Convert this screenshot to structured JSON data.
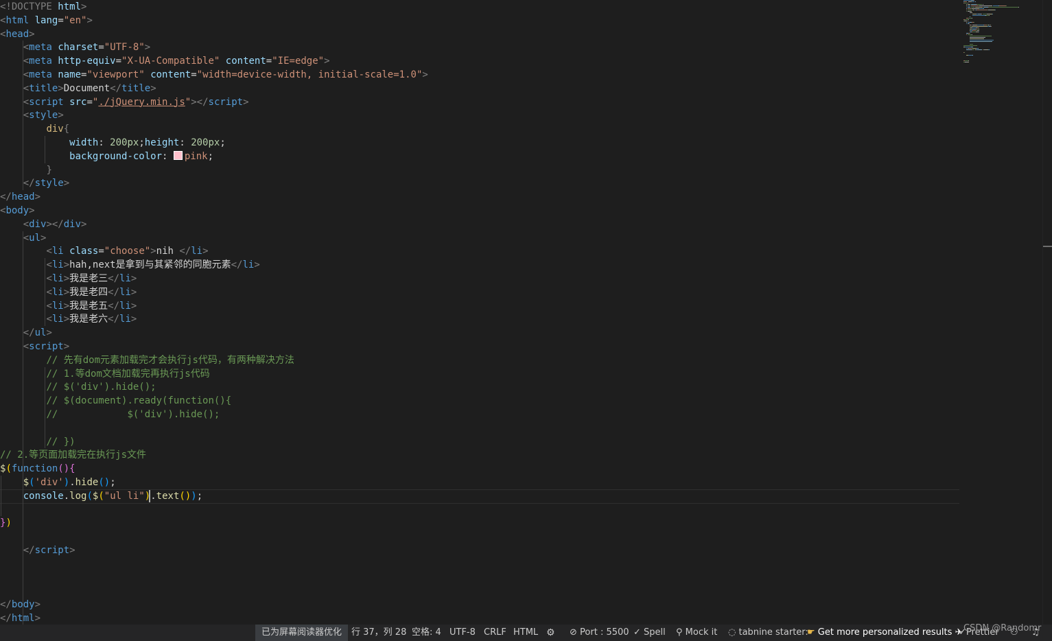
{
  "code_lines": [
    {
      "segments": [
        {
          "t": "<!DOCTYPE ",
          "c": "br"
        },
        {
          "t": "html",
          "c": "attr"
        },
        {
          "t": ">",
          "c": "br"
        }
      ]
    },
    {
      "segments": [
        {
          "t": "<",
          "c": "br"
        },
        {
          "t": "html",
          "c": "tag"
        },
        {
          "t": " ",
          "c": "txt"
        },
        {
          "t": "lang",
          "c": "attr"
        },
        {
          "t": "=",
          "c": "txt"
        },
        {
          "t": "\"en\"",
          "c": "str"
        },
        {
          "t": ">",
          "c": "br"
        }
      ]
    },
    {
      "segments": [
        {
          "t": "<",
          "c": "br"
        },
        {
          "t": "head",
          "c": "tag"
        },
        {
          "t": ">",
          "c": "br"
        }
      ]
    },
    {
      "segments": [
        {
          "t": "    ",
          "c": "txt"
        },
        {
          "t": "<",
          "c": "br"
        },
        {
          "t": "meta",
          "c": "tag"
        },
        {
          "t": " ",
          "c": "txt"
        },
        {
          "t": "charset",
          "c": "attr"
        },
        {
          "t": "=",
          "c": "txt"
        },
        {
          "t": "\"UTF-8\"",
          "c": "str"
        },
        {
          "t": ">",
          "c": "br"
        }
      ]
    },
    {
      "segments": [
        {
          "t": "    ",
          "c": "txt"
        },
        {
          "t": "<",
          "c": "br"
        },
        {
          "t": "meta",
          "c": "tag"
        },
        {
          "t": " ",
          "c": "txt"
        },
        {
          "t": "http-equiv",
          "c": "attr"
        },
        {
          "t": "=",
          "c": "txt"
        },
        {
          "t": "\"X-UA-Compatible\"",
          "c": "str"
        },
        {
          "t": " ",
          "c": "txt"
        },
        {
          "t": "content",
          "c": "attr"
        },
        {
          "t": "=",
          "c": "txt"
        },
        {
          "t": "\"IE=edge\"",
          "c": "str"
        },
        {
          "t": ">",
          "c": "br"
        }
      ]
    },
    {
      "segments": [
        {
          "t": "    ",
          "c": "txt"
        },
        {
          "t": "<",
          "c": "br"
        },
        {
          "t": "meta",
          "c": "tag"
        },
        {
          "t": " ",
          "c": "txt"
        },
        {
          "t": "name",
          "c": "attr"
        },
        {
          "t": "=",
          "c": "txt"
        },
        {
          "t": "\"viewport\"",
          "c": "str"
        },
        {
          "t": " ",
          "c": "txt"
        },
        {
          "t": "content",
          "c": "attr"
        },
        {
          "t": "=",
          "c": "txt"
        },
        {
          "t": "\"width=device-width, initial-scale=1.0\"",
          "c": "str"
        },
        {
          "t": ">",
          "c": "br"
        }
      ]
    },
    {
      "segments": [
        {
          "t": "    ",
          "c": "txt"
        },
        {
          "t": "<",
          "c": "br"
        },
        {
          "t": "title",
          "c": "tag"
        },
        {
          "t": ">",
          "c": "br"
        },
        {
          "t": "Document",
          "c": "txt"
        },
        {
          "t": "</",
          "c": "br"
        },
        {
          "t": "title",
          "c": "tag"
        },
        {
          "t": ">",
          "c": "br"
        }
      ]
    },
    {
      "segments": [
        {
          "t": "    ",
          "c": "txt"
        },
        {
          "t": "<",
          "c": "br"
        },
        {
          "t": "script",
          "c": "tag"
        },
        {
          "t": " ",
          "c": "txt"
        },
        {
          "t": "src",
          "c": "attr"
        },
        {
          "t": "=",
          "c": "txt"
        },
        {
          "t": "\"",
          "c": "str"
        },
        {
          "t": "./jQuery.min.js",
          "c": "link"
        },
        {
          "t": "\"",
          "c": "str"
        },
        {
          "t": "></",
          "c": "br"
        },
        {
          "t": "script",
          "c": "tag"
        },
        {
          "t": ">",
          "c": "br"
        }
      ]
    },
    {
      "segments": [
        {
          "t": "    ",
          "c": "txt"
        },
        {
          "t": "<",
          "c": "br"
        },
        {
          "t": "style",
          "c": "tag"
        },
        {
          "t": ">",
          "c": "br"
        }
      ]
    },
    {
      "segments": [
        {
          "t": "        ",
          "c": "txt"
        },
        {
          "t": "div",
          "c": "sel"
        },
        {
          "t": "{",
          "c": "br"
        }
      ]
    },
    {
      "segments": [
        {
          "t": "            ",
          "c": "txt"
        },
        {
          "t": "width",
          "c": "prop"
        },
        {
          "t": ": ",
          "c": "txt"
        },
        {
          "t": "200px",
          "c": "num"
        },
        {
          "t": ";",
          "c": "txt"
        },
        {
          "t": "height",
          "c": "prop"
        },
        {
          "t": ": ",
          "c": "txt"
        },
        {
          "t": "200px",
          "c": "num"
        },
        {
          "t": ";",
          "c": "txt"
        }
      ]
    },
    {
      "segments": [
        {
          "t": "            ",
          "c": "txt"
        },
        {
          "t": "background-color",
          "c": "prop"
        },
        {
          "t": ": ",
          "c": "txt"
        },
        {
          "t": "",
          "c": "swatch"
        },
        {
          "t": "pink",
          "c": "str"
        },
        {
          "t": ";",
          "c": "txt"
        }
      ]
    },
    {
      "segments": [
        {
          "t": "        ",
          "c": "txt"
        },
        {
          "t": "}",
          "c": "br"
        }
      ]
    },
    {
      "segments": [
        {
          "t": "    ",
          "c": "txt"
        },
        {
          "t": "</",
          "c": "br"
        },
        {
          "t": "style",
          "c": "tag"
        },
        {
          "t": ">",
          "c": "br"
        }
      ]
    },
    {
      "segments": [
        {
          "t": "</",
          "c": "br"
        },
        {
          "t": "head",
          "c": "tag"
        },
        {
          "t": ">",
          "c": "br"
        }
      ]
    },
    {
      "segments": [
        {
          "t": "<",
          "c": "br"
        },
        {
          "t": "body",
          "c": "tag"
        },
        {
          "t": ">",
          "c": "br"
        }
      ]
    },
    {
      "segments": [
        {
          "t": "    ",
          "c": "txt"
        },
        {
          "t": "<",
          "c": "br"
        },
        {
          "t": "div",
          "c": "tag"
        },
        {
          "t": "></",
          "c": "br"
        },
        {
          "t": "div",
          "c": "tag"
        },
        {
          "t": ">",
          "c": "br"
        }
      ]
    },
    {
      "segments": [
        {
          "t": "    ",
          "c": "txt"
        },
        {
          "t": "<",
          "c": "br"
        },
        {
          "t": "ul",
          "c": "tag"
        },
        {
          "t": ">",
          "c": "br"
        }
      ]
    },
    {
      "segments": [
        {
          "t": "        ",
          "c": "txt"
        },
        {
          "t": "<",
          "c": "br"
        },
        {
          "t": "li",
          "c": "tag"
        },
        {
          "t": " ",
          "c": "txt"
        },
        {
          "t": "class",
          "c": "attr"
        },
        {
          "t": "=",
          "c": "txt"
        },
        {
          "t": "\"choose\"",
          "c": "str"
        },
        {
          "t": ">",
          "c": "br"
        },
        {
          "t": "nih ",
          "c": "txt"
        },
        {
          "t": "</",
          "c": "br"
        },
        {
          "t": "li",
          "c": "tag"
        },
        {
          "t": ">",
          "c": "br"
        }
      ]
    },
    {
      "segments": [
        {
          "t": "        ",
          "c": "txt"
        },
        {
          "t": "<",
          "c": "br"
        },
        {
          "t": "li",
          "c": "tag"
        },
        {
          "t": ">",
          "c": "br"
        },
        {
          "t": "hah,next是拿到与其紧邻的同胞元素",
          "c": "txt"
        },
        {
          "t": "</",
          "c": "br"
        },
        {
          "t": "li",
          "c": "tag"
        },
        {
          "t": ">",
          "c": "br"
        }
      ]
    },
    {
      "segments": [
        {
          "t": "        ",
          "c": "txt"
        },
        {
          "t": "<",
          "c": "br"
        },
        {
          "t": "li",
          "c": "tag"
        },
        {
          "t": ">",
          "c": "br"
        },
        {
          "t": "我是老三",
          "c": "txt"
        },
        {
          "t": "</",
          "c": "br"
        },
        {
          "t": "li",
          "c": "tag"
        },
        {
          "t": ">",
          "c": "br"
        }
      ]
    },
    {
      "segments": [
        {
          "t": "        ",
          "c": "txt"
        },
        {
          "t": "<",
          "c": "br"
        },
        {
          "t": "li",
          "c": "tag"
        },
        {
          "t": ">",
          "c": "br"
        },
        {
          "t": "我是老四",
          "c": "txt"
        },
        {
          "t": "</",
          "c": "br"
        },
        {
          "t": "li",
          "c": "tag"
        },
        {
          "t": ">",
          "c": "br"
        }
      ]
    },
    {
      "segments": [
        {
          "t": "        ",
          "c": "txt"
        },
        {
          "t": "<",
          "c": "br"
        },
        {
          "t": "li",
          "c": "tag"
        },
        {
          "t": ">",
          "c": "br"
        },
        {
          "t": "我是老五",
          "c": "txt"
        },
        {
          "t": "</",
          "c": "br"
        },
        {
          "t": "li",
          "c": "tag"
        },
        {
          "t": ">",
          "c": "br"
        }
      ]
    },
    {
      "segments": [
        {
          "t": "        ",
          "c": "txt"
        },
        {
          "t": "<",
          "c": "br"
        },
        {
          "t": "li",
          "c": "tag"
        },
        {
          "t": ">",
          "c": "br"
        },
        {
          "t": "我是老六",
          "c": "txt"
        },
        {
          "t": "</",
          "c": "br"
        },
        {
          "t": "li",
          "c": "tag"
        },
        {
          "t": ">",
          "c": "br"
        }
      ]
    },
    {
      "segments": [
        {
          "t": "    ",
          "c": "txt"
        },
        {
          "t": "</",
          "c": "br"
        },
        {
          "t": "ul",
          "c": "tag"
        },
        {
          "t": ">",
          "c": "br"
        }
      ]
    },
    {
      "segments": [
        {
          "t": "    ",
          "c": "txt"
        },
        {
          "t": "<",
          "c": "br"
        },
        {
          "t": "script",
          "c": "tag"
        },
        {
          "t": ">",
          "c": "br"
        }
      ]
    },
    {
      "segments": [
        {
          "t": "        ",
          "c": "txt"
        },
        {
          "t": "// 先有dom元素加载完才会执行js代码，有两种解决方法",
          "c": "cm"
        }
      ]
    },
    {
      "segments": [
        {
          "t": "        ",
          "c": "txt"
        },
        {
          "t": "// 1.等dom文档加载完再执行js代码",
          "c": "cm"
        }
      ]
    },
    {
      "segments": [
        {
          "t": "        ",
          "c": "txt"
        },
        {
          "t": "// $('div').hide();",
          "c": "cm"
        }
      ]
    },
    {
      "segments": [
        {
          "t": "        ",
          "c": "txt"
        },
        {
          "t": "// $(document).ready(function(){",
          "c": "cm"
        }
      ]
    },
    {
      "segments": [
        {
          "t": "        ",
          "c": "txt"
        },
        {
          "t": "//            $('div').hide();",
          "c": "cm"
        }
      ]
    },
    {
      "segments": [
        {
          "t": "",
          "c": "txt"
        }
      ]
    },
    {
      "segments": [
        {
          "t": "        ",
          "c": "txt"
        },
        {
          "t": "// })",
          "c": "cm"
        }
      ]
    },
    {
      "segments": [
        {
          "t": "// 2.等页面加载完在执行js文件",
          "c": "cm"
        }
      ]
    },
    {
      "segments": [
        {
          "t": "$",
          "c": "fn"
        },
        {
          "t": "(",
          "c": "p1"
        },
        {
          "t": "function",
          "c": "tag"
        },
        {
          "t": "(){",
          "c": "p2"
        }
      ]
    },
    {
      "segments": [
        {
          "t": "    ",
          "c": "txt"
        },
        {
          "t": "$",
          "c": "fn"
        },
        {
          "t": "(",
          "c": "p3"
        },
        {
          "t": "'div'",
          "c": "str"
        },
        {
          "t": ")",
          "c": "p3"
        },
        {
          "t": ".",
          "c": "txt"
        },
        {
          "t": "hide",
          "c": "fn"
        },
        {
          "t": "()",
          "c": "p3"
        },
        {
          "t": ";",
          "c": "txt"
        }
      ]
    },
    {
      "segments": [
        {
          "t": "    ",
          "c": "txt"
        },
        {
          "t": "console",
          "c": "prop"
        },
        {
          "t": ".",
          "c": "txt"
        },
        {
          "t": "log",
          "c": "fn"
        },
        {
          "t": "(",
          "c": "p3"
        },
        {
          "t": "$",
          "c": "fn"
        },
        {
          "t": "(",
          "c": "p1"
        },
        {
          "t": "\"ul li\"",
          "c": "str"
        },
        {
          "t": ")",
          "c": "p1"
        },
        {
          "t": ".",
          "c": "txt"
        },
        {
          "t": "text",
          "c": "fn"
        },
        {
          "t": "()",
          "c": "p1"
        },
        {
          "t": ")",
          "c": "p3"
        },
        {
          "t": ";",
          "c": "txt"
        }
      ]
    },
    {
      "segments": [
        {
          "t": "",
          "c": "txt"
        }
      ]
    },
    {
      "segments": [
        {
          "t": "}",
          "c": "p2"
        },
        {
          "t": ")",
          "c": "p1"
        }
      ]
    },
    {
      "segments": [
        {
          "t": "",
          "c": "txt"
        }
      ]
    },
    {
      "segments": [
        {
          "t": "    ",
          "c": "txt"
        },
        {
          "t": "</",
          "c": "br"
        },
        {
          "t": "script",
          "c": "tag"
        },
        {
          "t": ">",
          "c": "br"
        }
      ]
    },
    {
      "segments": [
        {
          "t": "",
          "c": "txt"
        }
      ]
    },
    {
      "segments": [
        {
          "t": "",
          "c": "txt"
        }
      ]
    },
    {
      "segments": [
        {
          "t": "",
          "c": "txt"
        }
      ]
    },
    {
      "segments": [
        {
          "t": "</",
          "c": "br"
        },
        {
          "t": "body",
          "c": "tag"
        },
        {
          "t": ">",
          "c": "br"
        }
      ]
    },
    {
      "segments": [
        {
          "t": "</",
          "c": "br"
        },
        {
          "t": "html",
          "c": "tag"
        },
        {
          "t": ">",
          "c": "br"
        }
      ]
    }
  ],
  "colors": {
    "editor_background": "#1e1e1e",
    "statusbar_background": "#252526",
    "tag": "#569cd6",
    "attribute": "#9cdcfe",
    "string": "#ce9178",
    "comment": "#6a9955",
    "function": "#dcdcaa",
    "swatch_pink": "#ffc0cb"
  },
  "statusbar": {
    "accessibility": "已为屏幕阅读器优化",
    "cursor_position": "行 37，列 28",
    "indent": "空格: 4",
    "encoding": "UTF-8",
    "eol": "CRLF",
    "language": "HTML",
    "copilot_icon": "copilot-icon",
    "port_icon": "no-entry-icon",
    "port": "Port : 5500",
    "spell_icon": "check-icon",
    "spell": "Spell",
    "mock_icon": "pin-icon",
    "mock": "Mock it",
    "tabnine_icon": "tabnine-icon",
    "tabnine": "tabnine starter:",
    "results_icon": "pointing-hand-icon",
    "results": "Get more personalized results",
    "rocket_icon": "rocket-icon",
    "prettier_icon": "double-check-icon",
    "prettier": "Prettier",
    "watermark": "CSDN @Randomr",
    "account_icon": "person-icon",
    "notifications_icon": "bell-icon"
  }
}
